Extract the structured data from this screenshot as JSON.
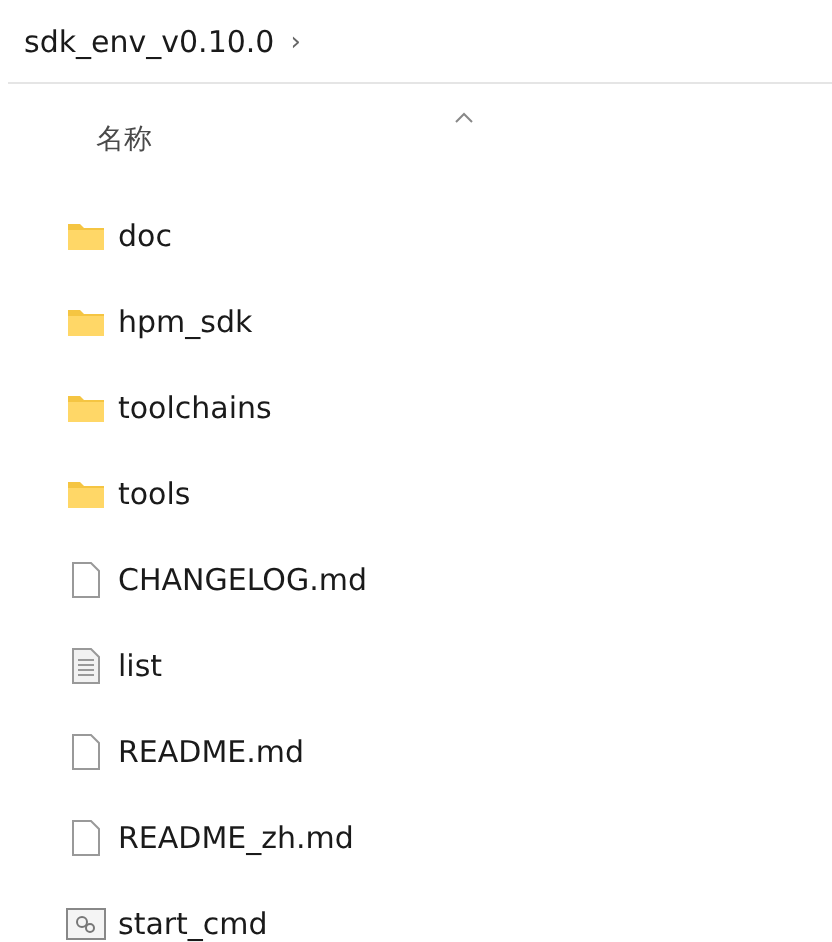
{
  "breadcrumb": {
    "label": "sdk_env_v0.10.0",
    "separator": "›"
  },
  "column_header": {
    "label": "名称",
    "sorted_ascending": true
  },
  "items": [
    {
      "name": "doc",
      "kind": "folder"
    },
    {
      "name": "hpm_sdk",
      "kind": "folder"
    },
    {
      "name": "toolchains",
      "kind": "folder"
    },
    {
      "name": "tools",
      "kind": "folder"
    },
    {
      "name": "CHANGELOG.md",
      "kind": "file"
    },
    {
      "name": "list",
      "kind": "text"
    },
    {
      "name": "README.md",
      "kind": "file"
    },
    {
      "name": "README_zh.md",
      "kind": "file"
    },
    {
      "name": "start_cmd",
      "kind": "script"
    }
  ]
}
